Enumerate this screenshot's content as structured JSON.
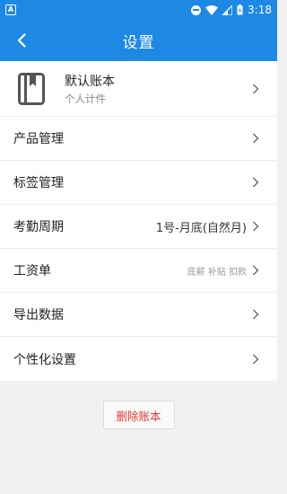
{
  "status": {
    "notification_letter": "A",
    "time": "3:18"
  },
  "header": {
    "title": "设置",
    "back_icon": "chevron-left-icon"
  },
  "account": {
    "name": "默认账本",
    "subtitle": "个人计件",
    "icon": "book-icon"
  },
  "rows": [
    {
      "label": "产品管理",
      "value": "",
      "hint": ""
    },
    {
      "label": "标签管理",
      "value": "",
      "hint": ""
    },
    {
      "label": "考勤周期",
      "value": "1号-月底(自然月)",
      "hint": ""
    },
    {
      "label": "工资单",
      "value": "",
      "hint": "底薪 补贴 扣款"
    },
    {
      "label": "导出数据",
      "value": "",
      "hint": ""
    },
    {
      "label": "个性化设置",
      "value": "",
      "hint": ""
    }
  ],
  "delete_button": {
    "label": "删除账本"
  },
  "colors": {
    "primary": "#1e88e5",
    "danger": "#e53935",
    "background": "#f1f1f1"
  }
}
